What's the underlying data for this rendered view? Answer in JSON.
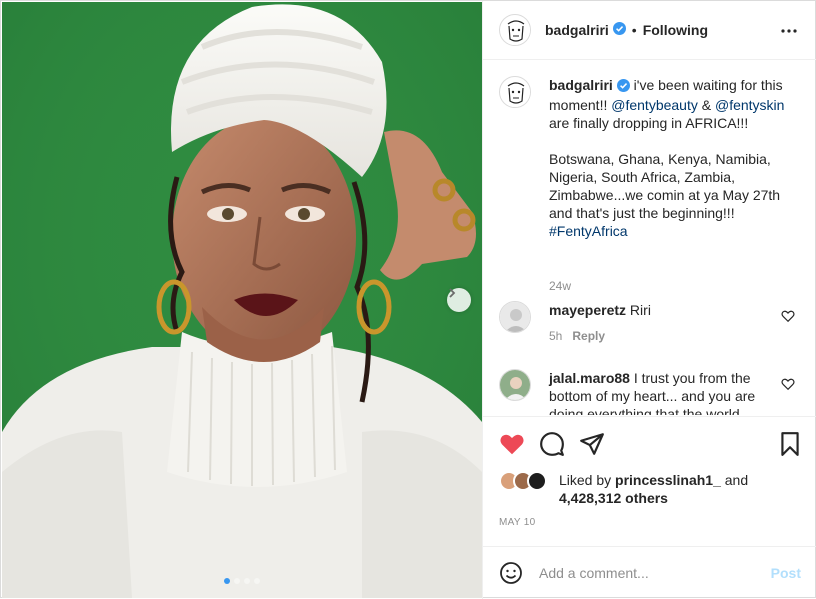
{
  "header": {
    "username": "badgalriri",
    "separator": "•",
    "follow_status": "Following",
    "more_icon": "more-horizontal-icon"
  },
  "caption": {
    "username": "badgalriri",
    "text_1": " i've been waiting for this moment!! ",
    "mention_1": "@fentybeauty",
    "text_2": " & ",
    "mention_2": "@fentyskin",
    "text_3": " are finally dropping in AFRICA!!!",
    "text_4": "Botswana, Ghana, Kenya, Namibia, Nigeria, South Africa, Zambia, Zimbabwe...we comin at ya May 27th and that's just the beginning!!!",
    "hashtag": "#FentyAfrica",
    "time": "24w"
  },
  "comments": [
    {
      "username": "mayeperetz",
      "text": " Riri",
      "time": "5h",
      "reply": "Reply"
    },
    {
      "username": "jalal.maro88",
      "text": " I trust you from the bottom of my heart... and you are doing everything that the world"
    }
  ],
  "likes": {
    "prefix": "Liked by ",
    "user": "princesslinah1_",
    "middle": " and",
    "count": "4,428,312 others"
  },
  "date": "MAY 10",
  "add_comment": {
    "placeholder": "Add a comment...",
    "post_label": "Post"
  },
  "colors": {
    "like_red": "#ed4956",
    "link_blue": "#00376b",
    "verified_blue": "#3897f0",
    "post_button_disabled": "#b2dffc",
    "background_green": "#2e8a3e"
  },
  "carousel": {
    "slides": 4,
    "active_index": 0
  }
}
